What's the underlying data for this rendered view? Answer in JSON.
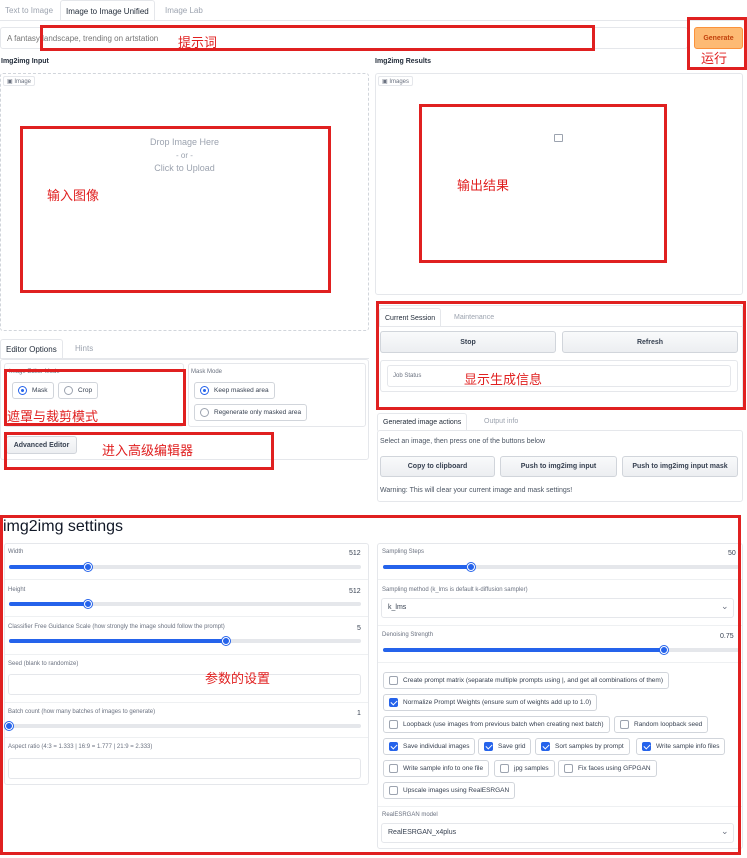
{
  "tabs": [
    "Text to Image",
    "Image to Image Unified",
    "Image Lab"
  ],
  "prompt": {
    "placeholder": "A fantasy landscape, trending on artstation"
  },
  "generate_label": "Generate",
  "input_panel": {
    "title": "Img2img Input",
    "image_badge": "Image",
    "drop_text": "Drop Image Here",
    "or_text": "- or -",
    "click_text": "Click to Upload"
  },
  "results_panel": {
    "title": "Img2img Results",
    "images_badge": "Images"
  },
  "editor": {
    "tabs": [
      "Editor Options",
      "Hints"
    ],
    "image_editor_mode_label": "Image Editor Mode",
    "mask_mode_label": "Mask Mode",
    "editor_modes": [
      "Mask",
      "Crop"
    ],
    "mask_modes": [
      "Keep masked area",
      "Regenerate only masked area"
    ],
    "advanced_editor_label": "Advanced Editor"
  },
  "session": {
    "tabs": [
      "Current Session",
      "Maintenance"
    ],
    "stop_label": "Stop",
    "refresh_label": "Refresh",
    "job_status_label": "Job Status"
  },
  "actions": {
    "tabs": [
      "Generated image actions",
      "Output info"
    ],
    "instruction": "Select an image, then press one of the buttons below",
    "buttons": [
      "Copy to clipboard",
      "Push to img2img input",
      "Push to img2img input mask"
    ],
    "warning": "Warning: This will clear your current image and mask settings!"
  },
  "settings": {
    "title": "img2img settings",
    "width": {
      "label": "Width",
      "value": 512,
      "min": 64,
      "max": 2048
    },
    "height": {
      "label": "Height",
      "value": 512,
      "min": 64,
      "max": 2048
    },
    "cfg": {
      "label": "Classifier Free Guidance Scale (how strongly the image should follow the prompt)",
      "value": 5,
      "min": 1,
      "max": 7.5
    },
    "seed": {
      "label": "Seed (blank to randomize)"
    },
    "batch": {
      "label": "Batch count (how many batches of images to generate)",
      "value": 1,
      "min": 1,
      "max": 100
    },
    "aspect": {
      "label": "Aspect ratio (4:3 = 1.333 | 16:9 = 1.777 | 21:9 = 2.333)"
    },
    "steps": {
      "label": "Sampling Steps",
      "value": 50,
      "min": 1,
      "max": 200
    },
    "sampler": {
      "label": "Sampling method (k_lms is default k-diffusion sampler)",
      "value": "k_lms"
    },
    "denoise": {
      "label": "Denoising Strength",
      "value": 0.75,
      "min": 0,
      "max": 0.95
    },
    "checkboxes": [
      {
        "label": "Create prompt matrix (separate multiple prompts using |, and get all combinations of them)",
        "checked": false
      },
      {
        "label": "Normalize Prompt Weights (ensure sum of weights add up to 1.0)",
        "checked": true
      },
      {
        "label": "Loopback (use images from previous batch when creating next batch)",
        "checked": false
      },
      {
        "label": "Random loopback seed",
        "checked": false
      },
      {
        "label": "Save individual images",
        "checked": true
      },
      {
        "label": "Save grid",
        "checked": true
      },
      {
        "label": "Sort samples by prompt",
        "checked": true
      },
      {
        "label": "Write sample info files",
        "checked": true
      },
      {
        "label": "Write sample info to one file",
        "checked": false
      },
      {
        "label": "jpg samples",
        "checked": false
      },
      {
        "label": "Fix faces using GFPGAN",
        "checked": false
      },
      {
        "label": "Upscale images using RealESRGAN",
        "checked": false
      }
    ],
    "realesrgan": {
      "label": "RealESRGAN model",
      "value": "RealESRGAN_x4plus"
    }
  },
  "annotations": {
    "prompt": "提示词",
    "run": "运行",
    "input_image": "输入图像",
    "output": "输出结果",
    "info": "显示生成信息",
    "mask_crop": "遮罩与裁剪模式",
    "advanced": "进入高级编辑器",
    "params": "参数的设置"
  },
  "colors": {
    "accent": "#2563eb",
    "generate_bg": "#fdba74",
    "generate_text": "#c2410c",
    "annotation": "#e02020"
  }
}
